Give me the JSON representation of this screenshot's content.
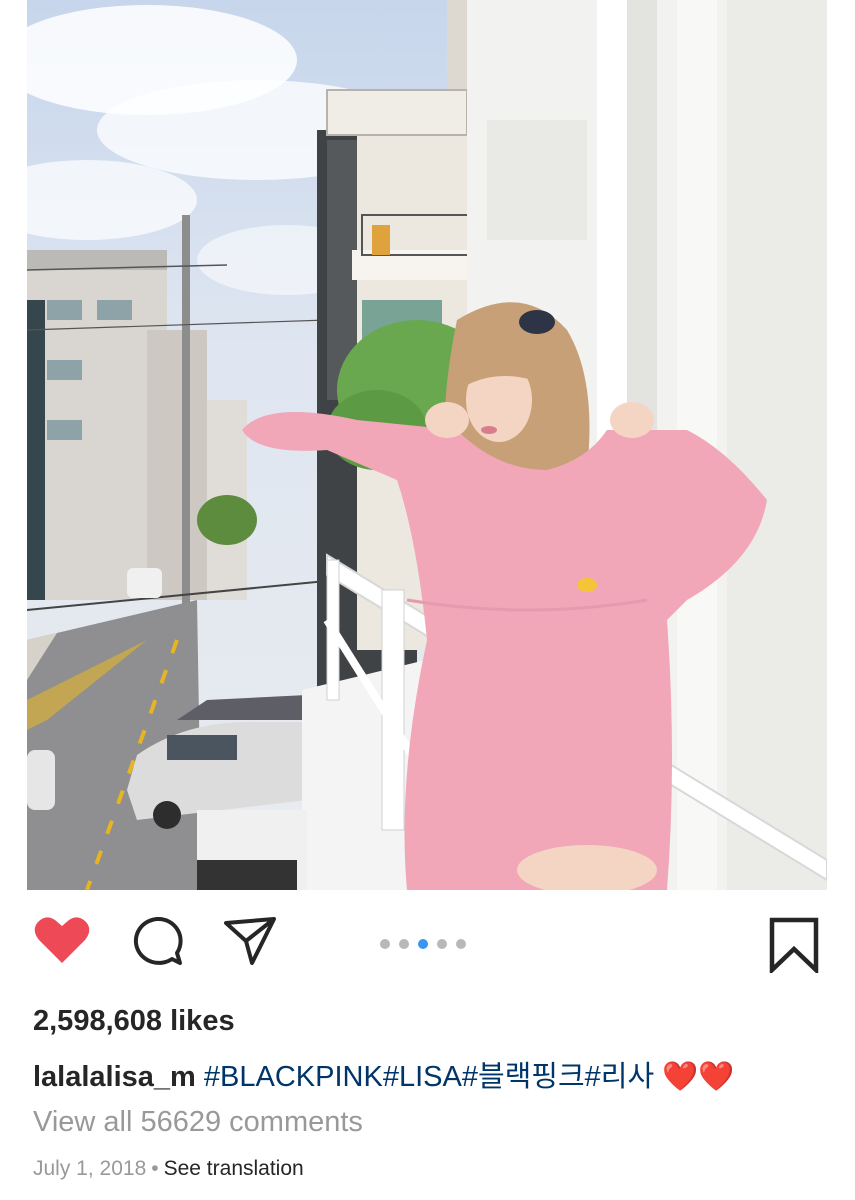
{
  "post": {
    "image_alt": "Woman in pink long shirt on balcony",
    "likes": "2,598,608 likes",
    "username": "lalalalisa_m",
    "caption_text": "#BLACKPINK#LISA#블랙핑크#리사",
    "caption_emoji": "❤️❤️",
    "view_comments": "View all 56629 comments",
    "date": "July 1, 2018",
    "separator": "•",
    "see_translation": "See translation"
  },
  "carousel": {
    "count": 5,
    "active_index": 2
  },
  "icons": {
    "like": "heart-icon",
    "comment": "comment-icon",
    "share": "send-icon",
    "save": "bookmark-icon"
  },
  "colors": {
    "heart": "#ed4956",
    "dot_active": "#3897f0",
    "dot_inactive": "#b8b8b8",
    "hashtag": "#003569",
    "muted": "#999999"
  }
}
